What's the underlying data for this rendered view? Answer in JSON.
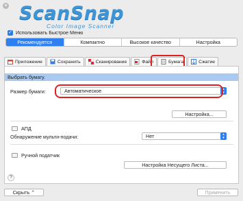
{
  "logo": {
    "title": "ScanSnap",
    "subtitle": "Color Image Scanner"
  },
  "quick_menu": {
    "label": "Использовать Быстрое Меню",
    "checked": true
  },
  "profiles": [
    {
      "label": "Рекомендуется",
      "active": true
    },
    {
      "label": "Компактно",
      "active": false
    },
    {
      "label": "Высокое качество",
      "active": false
    },
    {
      "label": "Настройка",
      "active": false
    }
  ],
  "tabs": [
    {
      "label": "Приложение",
      "icon": "application-icon"
    },
    {
      "label": "Сохранить",
      "icon": "save-icon"
    },
    {
      "label": "Сканирование",
      "icon": "scan-icon"
    },
    {
      "label": "Файл",
      "icon": "file-icon"
    },
    {
      "label": "Бумага",
      "icon": "paper-icon",
      "active": true
    },
    {
      "label": "Сжатие",
      "icon": "compression-icon"
    }
  ],
  "panel": {
    "title": "Выбрать бумагу.",
    "paper_size_label": "Размер бумаги:",
    "paper_size_value": "Автоматическое",
    "settings_button": "Настройка...",
    "adf_label": "АПД",
    "multifeed_label": "Обнаружение мульти-подачи:",
    "multifeed_value": "Нет",
    "manual_feeder_label": "Ручной податчик",
    "carrier_sheet_button": "Настройка Несущего Листа...",
    "help_glyph": "?"
  },
  "footer": {
    "hide_button": "Скрыть",
    "apply_button": "Применить"
  },
  "colors": {
    "accent": "#2e7ff0",
    "highlight": "#e02020",
    "panel_header": "#a9c9ee"
  }
}
